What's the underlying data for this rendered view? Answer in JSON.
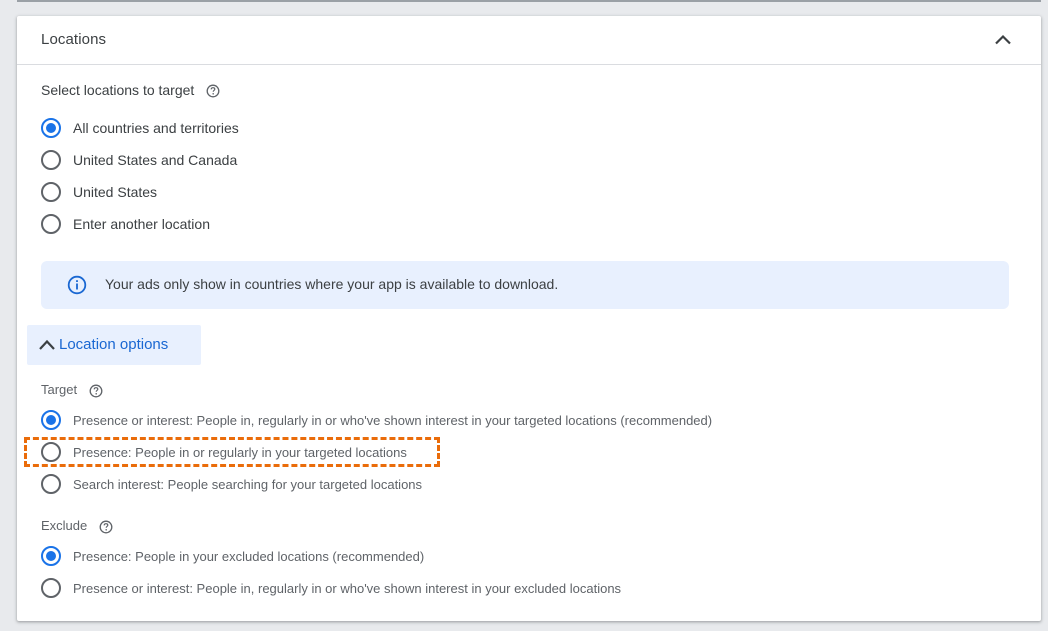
{
  "locations_panel": {
    "title": "Locations",
    "select_label": "Select locations to target",
    "location_radios": [
      {
        "label": "All countries and territories",
        "checked": true
      },
      {
        "label": "United States and Canada",
        "checked": false
      },
      {
        "label": "United States",
        "checked": false
      },
      {
        "label": "Enter another location",
        "checked": false
      }
    ],
    "info_text": "Your ads only show in countries where your app is available to download.",
    "location_options_label": "Location options",
    "target": {
      "label": "Target",
      "options": [
        {
          "label": "Presence or interest: People in, regularly in or who've shown interest in your targeted locations (recommended)",
          "checked": true
        },
        {
          "label": "Presence: People in or regularly in your targeted locations",
          "checked": false,
          "highlighted": true
        },
        {
          "label": "Search interest: People searching for your targeted locations",
          "checked": false
        }
      ]
    },
    "exclude": {
      "label": "Exclude",
      "options": [
        {
          "label": "Presence: People in your excluded locations (recommended)",
          "checked": true
        },
        {
          "label": "Presence or interest: People in, regularly in or who've shown interest in your excluded locations",
          "checked": false
        }
      ]
    }
  },
  "icons": {
    "collapse": "chevron-up-icon",
    "help": "help-circle-icon",
    "info": "info-icon",
    "location_options": "chevron-up-icon"
  },
  "colors": {
    "accent": "#1a73e8",
    "banner_bg": "#e8f0fe",
    "highlight": "#ea6c0a"
  }
}
